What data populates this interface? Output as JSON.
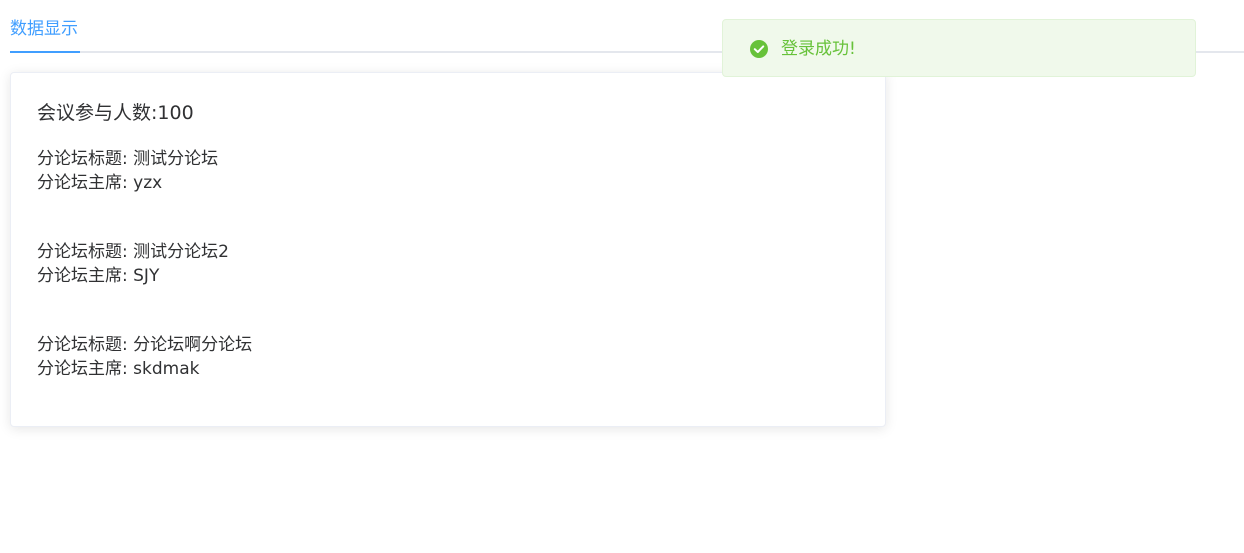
{
  "tabs": {
    "items": [
      {
        "label": "数据显示"
      }
    ]
  },
  "stats": {
    "attendee_label": "会议参与人数",
    "attendee_count": "100"
  },
  "forums": [
    {
      "title_label": "分论坛标题",
      "title": "测试分论坛",
      "chair_label": "分论坛主席",
      "chair": "yzx"
    },
    {
      "title_label": "分论坛标题",
      "title": "测试分论坛2",
      "chair_label": "分论坛主席",
      "chair": "SJY"
    },
    {
      "title_label": "分论坛标题",
      "title": "分论坛啊分论坛",
      "chair_label": "分论坛主席",
      "chair": "skdmak"
    }
  ],
  "toast": {
    "message": "登录成功!",
    "icon": "check-circle-icon",
    "color": "#67c23a"
  },
  "colors": {
    "accent": "#409eff",
    "success": "#67c23a",
    "success_bg": "#f0f9eb"
  }
}
